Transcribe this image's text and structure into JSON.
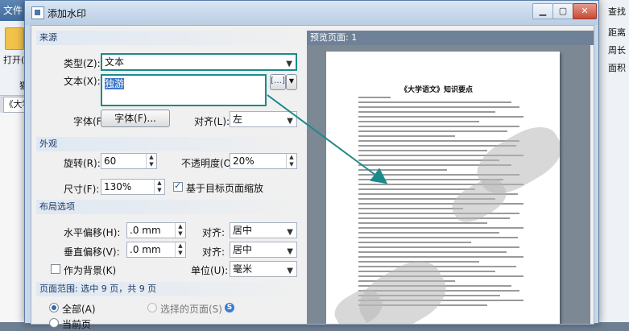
{
  "background_app": {
    "menu_file": "文件",
    "toolbar_open": "打开(",
    "lang_label": "猫",
    "doc_tab": "《大学",
    "right_items": [
      "查找",
      "距离",
      "周长",
      "面积"
    ]
  },
  "dialog": {
    "title": "添加水印",
    "source": {
      "header": "来源",
      "type_label": "类型(Z):",
      "type_value": "文本",
      "text_label": "文本(X):",
      "text_value": "独游",
      "text_options_button": "[…]",
      "font_label": "字体(F):",
      "font_button": "字体(F)...",
      "align_label": "对齐(L):",
      "align_value": "左"
    },
    "appearance": {
      "header": "外观",
      "rotation_label": "旋转(R):",
      "rotation_value": "60",
      "opacity_label": "不透明度(O):",
      "opacity_value": "20%",
      "size_label": "尺寸(F):",
      "size_value": "130%",
      "scale_to_page_label": "基于目标页面缩放",
      "scale_to_page_checked": true
    },
    "layout": {
      "header": "布局选项",
      "h_offset_label": "水平偏移(H):",
      "h_offset_value": ".0 mm",
      "h_align_label": "对齐:",
      "h_align_value": "居中",
      "v_offset_label": "垂直偏移(V):",
      "v_offset_value": ".0 mm",
      "v_align_label": "对齐:",
      "v_align_value": "居中",
      "as_background_label": "作为背景(K)",
      "as_background_checked": false,
      "unit_label": "单位(U):",
      "unit_value": "毫米"
    },
    "page_range": {
      "header": "页面范围: 选中 9 页，共 9 页",
      "all_label": "全部(A)",
      "selected_label": "选择的页面(S)",
      "current_label": "当前页"
    },
    "preview": {
      "header": "预览页面: 1",
      "page_title": "《大学语文》知识要点"
    }
  }
}
